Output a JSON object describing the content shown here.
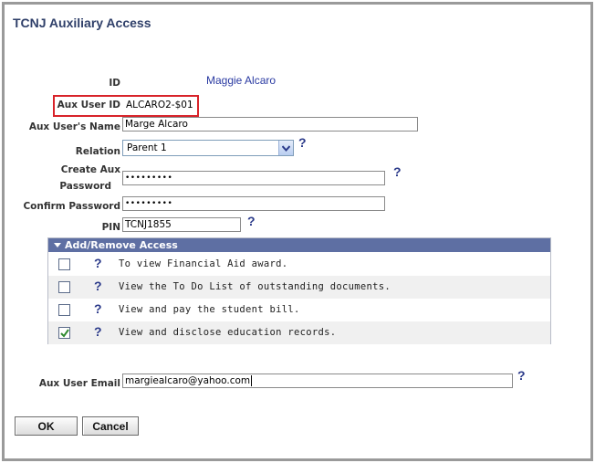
{
  "page": {
    "title": "TCNJ Auxiliary Access"
  },
  "form": {
    "id_label": "ID",
    "id_value": "Maggie Alcaro",
    "aux_user_id_label": "Aux User ID",
    "aux_user_id_value": "ALCARO2-$01",
    "aux_name_label": "Aux User's Name",
    "aux_name_value": "Marge Alcaro",
    "relation_label": "Relation",
    "relation_value": "Parent 1",
    "create_pwd_label_line1": "Create Aux",
    "create_pwd_label_line2": "Password",
    "create_pwd_value": "•••••••••",
    "confirm_pwd_label": "Confirm Password",
    "confirm_pwd_value": "•••••••••",
    "pin_label": "PIN",
    "pin_value": "TCNJ1855",
    "email_label": "Aux User Email",
    "email_value": "margiealcaro@yahoo.com"
  },
  "access": {
    "header": "Add/Remove Access",
    "rows": [
      {
        "text": "To view Financial Aid award.",
        "checked": false
      },
      {
        "text": "View the To Do List of outstanding documents.",
        "checked": false
      },
      {
        "text": "View  and pay the student bill.",
        "checked": false
      },
      {
        "text": "View and disclose education records.",
        "checked": true
      }
    ]
  },
  "help_symbol": "?",
  "buttons": {
    "ok": "OK",
    "cancel": "Cancel"
  },
  "colors": {
    "title": "#30406a",
    "grid_header": "#5e6fa3",
    "highlight_border": "#d8232a",
    "link_blue": "#2a3aa2",
    "check_green": "#2f8a2f"
  }
}
